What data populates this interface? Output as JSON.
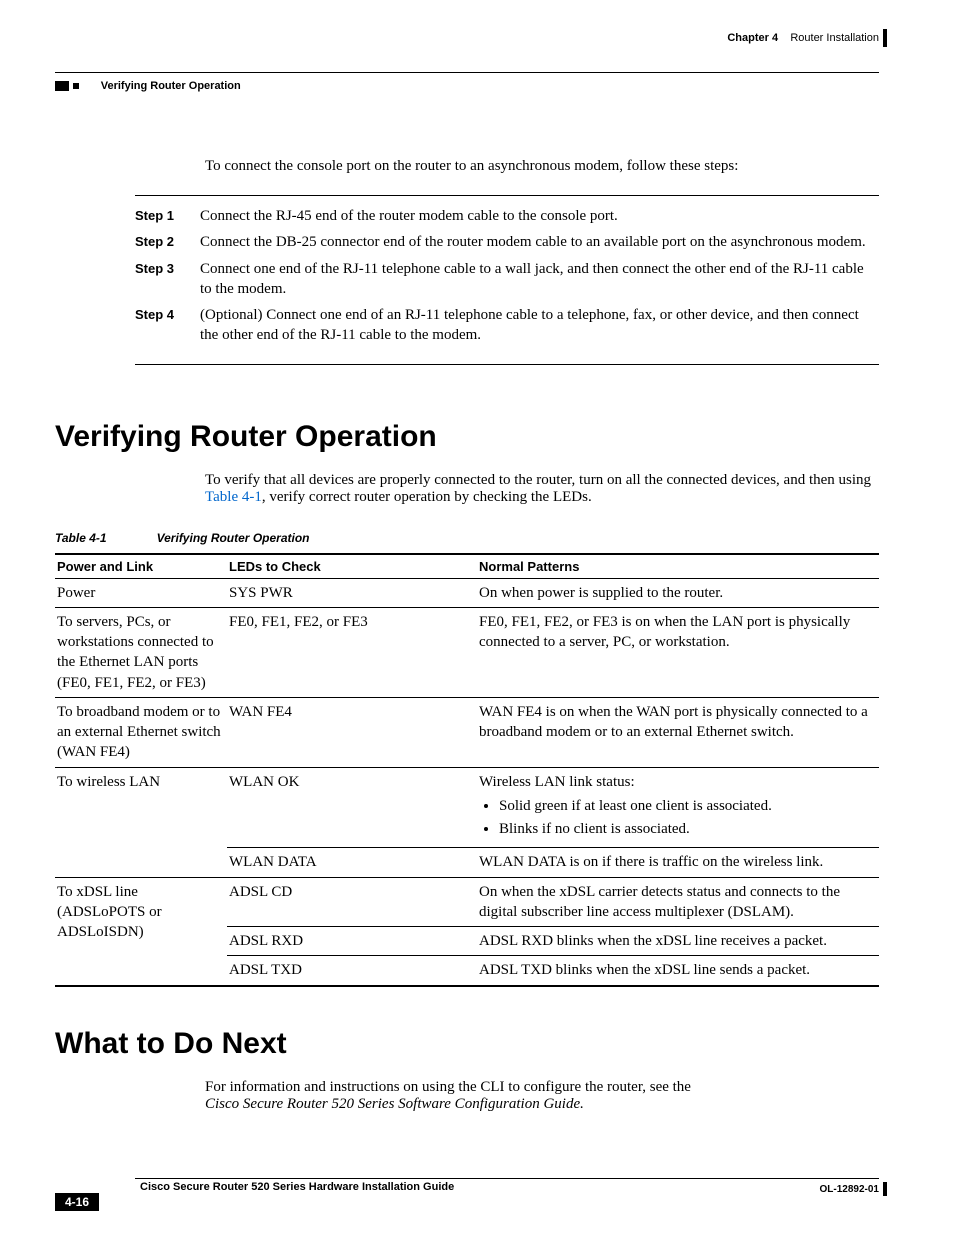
{
  "header": {
    "chapter_label": "Chapter 4",
    "chapter_title": "Router Installation",
    "section_label": "Verifying Router Operation"
  },
  "intro": "To connect the console port on the router to an asynchronous modem, follow these steps:",
  "steps": [
    {
      "label": "Step 1",
      "text": "Connect the RJ-45 end of the router modem cable to the console port."
    },
    {
      "label": "Step 2",
      "text": "Connect the DB-25 connector end of the router modem cable to an available port on the asynchronous modem."
    },
    {
      "label": "Step 3",
      "text": "Connect one end of the RJ-11 telephone cable to a wall jack, and then connect the other end of the RJ-11 cable to the modem."
    },
    {
      "label": "Step 4",
      "text": "(Optional) Connect one end of an RJ-11 telephone cable to a telephone, fax, or other device, and then connect the other end of the RJ-11 cable to the modem."
    }
  ],
  "h1a": "Verifying Router Operation",
  "verify_intro_pre": "To verify that all devices are properly connected to the router, turn on all the connected devices, and then using ",
  "verify_intro_link": "Table 4-1",
  "verify_intro_post": ", verify correct router operation by checking the LEDs.",
  "table": {
    "number": "Table 4-1",
    "title": "Verifying Router Operation",
    "headers": {
      "c1": "Power and Link",
      "c2": "LEDs to Check",
      "c3": "Normal Patterns"
    },
    "rows": {
      "r1": {
        "c1": "Power",
        "c2": "SYS PWR",
        "c3": "On when power is supplied to the router."
      },
      "r2": {
        "c1": "To servers, PCs, or workstations connected to the Ethernet LAN ports (FE0, FE1, FE2, or FE3)",
        "c2": "FE0, FE1, FE2, or FE3",
        "c3": "FE0, FE1, FE2, or FE3 is on when the LAN port is physically connected to a server, PC, or workstation."
      },
      "r3": {
        "c1": "To broadband modem or to an external Ethernet switch (WAN FE4)",
        "c2": "WAN FE4",
        "c3": "WAN FE4 is on when the WAN port is physically connected to a broadband modem or to an external Ethernet switch."
      },
      "r4": {
        "c1": "To wireless LAN",
        "c2a": "WLAN OK",
        "c3a_head": "Wireless LAN link status:",
        "c3a_b1": "Solid green if at least one client is associated.",
        "c3a_b2": "Blinks if no client is associated.",
        "c2b": "WLAN DATA",
        "c3b": "WLAN DATA is on if there is traffic on the wireless link."
      },
      "r5": {
        "c1": "To xDSL line (ADSLoPOTS or ADSLoISDN)",
        "c2a": "ADSL CD",
        "c3a": "On when the xDSL carrier detects status and connects to the digital subscriber line access multiplexer (DSLAM).",
        "c2b": "ADSL RXD",
        "c3b": "ADSL RXD blinks when the xDSL line receives a packet.",
        "c2c": "ADSL TXD",
        "c3c": "ADSL TXD blinks when the xDSL line sends a packet."
      }
    }
  },
  "h1b": "What to Do Next",
  "next_text_pre": "For information and instructions on using the CLI to configure the router, see the ",
  "next_text_italic": "Cisco Secure Router 520 Series Software Configuration Guide.",
  "footer": {
    "title": "Cisco Secure Router 520 Series Hardware Installation Guide",
    "docid": "OL-12892-01",
    "page": "4-16"
  }
}
